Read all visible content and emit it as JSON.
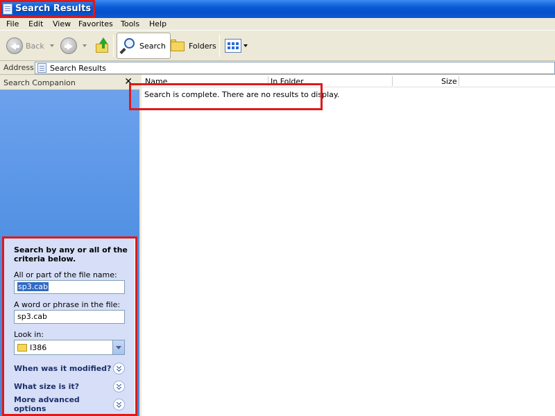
{
  "window": {
    "title": "Search Results"
  },
  "menu": [
    "File",
    "Edit",
    "View",
    "Favorites",
    "Tools",
    "Help"
  ],
  "toolbar": {
    "back_label": "Back",
    "search_label": "Search",
    "folders_label": "Folders"
  },
  "address": {
    "label": "Address",
    "value": "Search Results"
  },
  "companion": {
    "header": "Search Companion",
    "close_glyph": "✕",
    "heading": "Search by any or all of the criteria below.",
    "filename_label": "All or part of the file name:",
    "filename_value": "sp3.cab",
    "phrase_label": "A word or phrase in the file:",
    "phrase_value": "sp3.cab",
    "lookin_label": "Look in:",
    "lookin_value": "I386",
    "expanders": [
      "When was it modified?",
      "What size is it?",
      "More advanced options"
    ]
  },
  "results": {
    "columns": [
      "Name",
      "In Folder",
      "Size"
    ],
    "message": "Search is complete. There are no results to display."
  },
  "colors": {
    "highlight": "#e01818",
    "titlebar": "#0a5ad8",
    "panel": "#d6dff7"
  }
}
